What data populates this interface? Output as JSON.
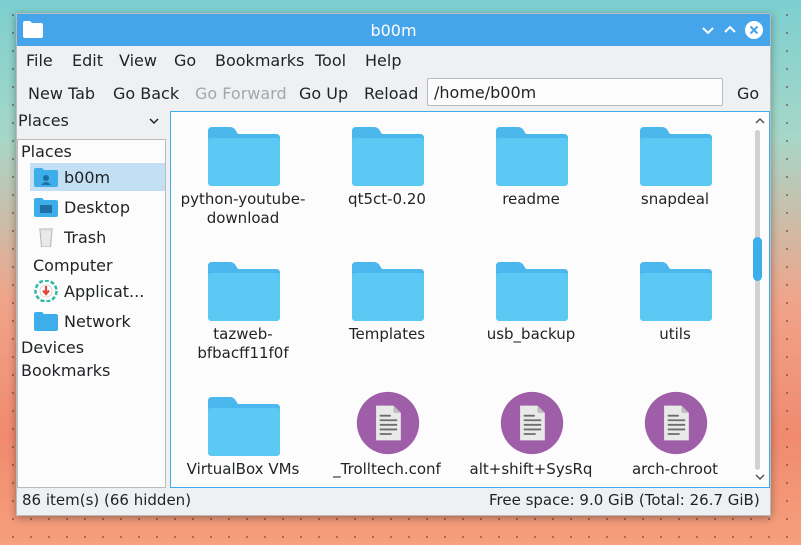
{
  "window": {
    "title": "b00m",
    "accent": "#45a4ea"
  },
  "menubar": {
    "items": [
      "File",
      "Edit",
      "View",
      "Go",
      "Bookmarks",
      "Tool",
      "Help"
    ]
  },
  "toolbar": {
    "new_tab": "New Tab",
    "go_back": "Go Back",
    "go_forward": "Go Forward",
    "go_up": "Go Up",
    "reload": "Reload",
    "path": "/home/b00m",
    "go": "Go"
  },
  "places": {
    "header": "Places",
    "sections": {
      "places": "Places",
      "computer": "Computer",
      "devices": "Devices",
      "bookmarks": "Bookmarks"
    },
    "items": {
      "home": "b00m",
      "desktop": "Desktop",
      "trash": "Trash",
      "applications": "Applicat...",
      "network": "Network"
    }
  },
  "files": [
    {
      "name": "python-youtube-\ndownload",
      "type": "folder"
    },
    {
      "name": "qt5ct-0.20",
      "type": "folder"
    },
    {
      "name": "readme",
      "type": "folder"
    },
    {
      "name": "snapdeal",
      "type": "folder"
    },
    {
      "name": "tazweb-bfbacff11f0f",
      "type": "folder"
    },
    {
      "name": "Templates",
      "type": "folder"
    },
    {
      "name": "usb_backup",
      "type": "folder"
    },
    {
      "name": "utils",
      "type": "folder"
    },
    {
      "name": "VirtualBox VMs",
      "type": "folder"
    },
    {
      "name": "_Trolltech.conf",
      "type": "text-file"
    },
    {
      "name": "alt+shift+SysRq",
      "type": "text-file"
    },
    {
      "name": "arch-chroot",
      "type": "text-file"
    }
  ],
  "status": {
    "items": "86 item(s) (66 hidden)",
    "free_space": "Free space: 9.0 GiB (Total: 26.7 GiB)"
  }
}
